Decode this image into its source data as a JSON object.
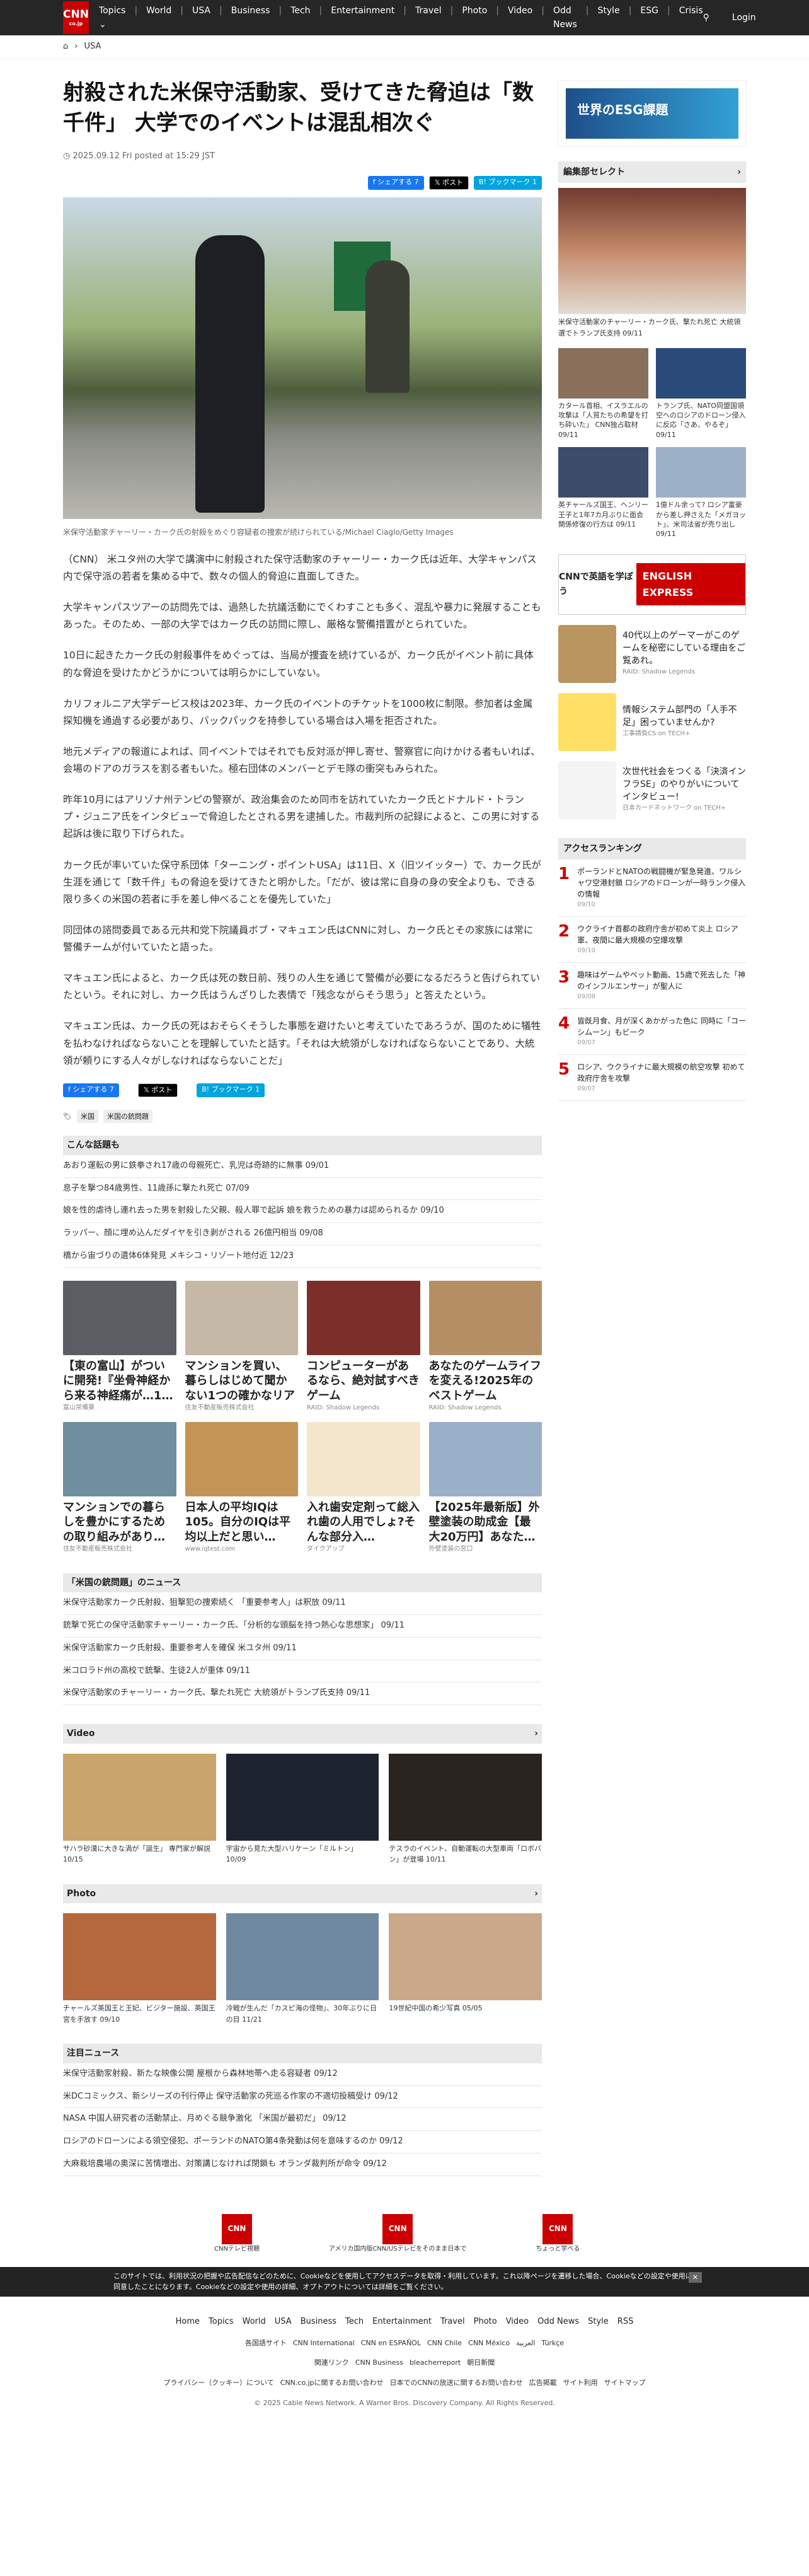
{
  "header": {
    "logo": "CNN",
    "logo_sub": "co.jp",
    "nav": [
      "Topics ⌄",
      "World",
      "USA",
      "Business",
      "Tech",
      "Entertainment",
      "Travel",
      "Photo",
      "Video",
      "Odd News",
      "Style",
      "ESG",
      "Crisis"
    ],
    "login": "Login"
  },
  "breadcrumb": {
    "section": "USA"
  },
  "article": {
    "title": "射殺された米保守活動家、受けてきた脅迫は「数千件」 大学でのイベントは混乱相次ぐ",
    "date": "2025.09.12 Fri posted at 15:29 JST",
    "share_fb": "f シェアする 7",
    "share_tw": "𝕏 ポスト",
    "share_hb": "B! ブックマーク 1",
    "caption": "米保守活動家チャーリー・カーク氏の射殺をめぐり容疑者の捜索が続けられている/Michael Ciaglo/Getty Images",
    "paragraphs": [
      "（CNN） 米ユタ州の大学で講演中に射殺された保守活動家のチャーリー・カーク氏は近年、大学キャンパス内で保守派の若者を集める中で、数々の個人的脅迫に直面してきた。",
      "大学キャンパスツアーの訪問先では、過熱した抗議活動にでくわすことも多く、混乱や暴力に発展することもあった。そのため、一部の大学ではカーク氏の訪問に際し、厳格な警備措置がとられていた。",
      "10日に起きたカーク氏の射殺事件をめぐっては、当局が捜査を続けているが、カーク氏がイベント前に具体的な脅迫を受けたかどうかについては明らかにしていない。",
      "カリフォルニア大学デービス校は2023年、カーク氏のイベントのチケットを1000枚に制限。参加者は金属探知機を通過する必要があり、バックパックを持参している場合は入場を拒否された。",
      "地元メディアの報道によれば、同イベントではそれでも反対派が押し寄せ、警察官に向けかける者もいれば、会場のドアのガラスを割る者もいた。極右団体のメンバーとデモ隊の衝突もみられた。",
      "昨年10月にはアリゾナ州テンピの警察が、政治集会のため同市を訪れていたカーク氏とドナルド・トランプ・ジュニア氏をインタビューで脅迫したとされる男を逮捕した。市裁判所の記録によると、この男に対する起訴は後に取り下げられた。",
      "カーク氏が率いていた保守系団体「ターニング・ポイントUSA」は11日、X（旧ツイッター）で、カーク氏が生涯を通じて「数千件」もの脅迫を受けてきたと明かした。「だが、彼は常に自身の身の安全よりも、できる限り多くの米国の若者に手を差し伸べることを優先していた」",
      "同団体の諮問委員である元共和党下院議員ボブ・マキュエン氏はCNNに対し、カーク氏とその家族には常に警備チームが付いていたと語った。",
      "マキュエン氏によると、カーク氏は死の数日前、残りの人生を通じて警備が必要になるだろうと告げられていたという。それに対し、カーク氏はうんざりした表情で「残念ながらそう思う」と答えたという。",
      "マキュエン氏は、カーク氏の死はおそらくそうした事態を避けたいと考えていたであろうが、国のために犠牲を払わなければならないことを理解していたと話す。「それは大統領がしなければならないことであり、大統領が頼りにする人々がしなければならないことだ」"
    ],
    "tags": [
      "米国",
      "米国の銃問題"
    ]
  },
  "recommend": {
    "title": "こんな話題も",
    "items": [
      "あおり運転の男に鉄拳され17歳の母親死亡、乳児は奇跡的に無事 09/01",
      "息子を撃つ84歳男性、11歳孫に撃たれ死亡 07/09",
      "娘を性的虐待し連れ去った男を射殺した父親、殺人罪で起訴 娘を救うための暴力は認められるか 09/10",
      "ラッパー、顔に埋め込んだダイヤを引き剥がされる 26億円相当 09/08",
      "橋から宙づりの遺体6体発見 メキシコ・リゾート地付近 12/23"
    ]
  },
  "ads": [
    {
      "title": "【東の富山】がついに開発!『坐骨神経から来る神経痛が…1…",
      "src": "富山常備薬",
      "color": "#5a5d62"
    },
    {
      "title": "マンションを買い、暮らしはじめて聞かない1つの確かなリアル…",
      "src": "住友不動産販売株式会社",
      "color": "#c6b8a6"
    },
    {
      "title": "コンピューターがあるなら、絶対試すべきゲーム",
      "src": "RAID: Shadow Legends",
      "color": "#7b2e2a"
    },
    {
      "title": "あなたのゲームライフを変える!2025年のベストゲーム",
      "src": "RAID: Shadow Legends",
      "color": "#b58f63"
    },
    {
      "title": "マンションでの暮らしを豊かにするための取り組みがあり…",
      "src": "住友不動産販売株式会社",
      "color": "#6f8f9e"
    },
    {
      "title": "日本人の平均IQは105。自分のIQは平均以上だと思い…",
      "src": "www.iqtest.com",
      "color": "#c29455"
    },
    {
      "title": "入れ歯安定剤って総入れ歯の人用でしょ?そんな部分入…",
      "src": "ダイクアップ",
      "color": "#f3e6cc"
    },
    {
      "title": "【2025年最新版】外壁塗装の助成金【最大20万円】あなた…",
      "src": "外壁塗装の窓口",
      "color": "#9ab0c8"
    }
  ],
  "news_gun": {
    "title": "「米国の銃問題」のニュース",
    "items": [
      "米保守活動家カーク氏射殺、狙撃犯の捜索続く 「重要参考人」は釈放 09/11",
      "銃撃で死亡の保守活動家チャーリー・カーク氏、「分析的な頭脳を持つ熱心な思想家」 09/11",
      "米保守活動家カーク氏射殺、重要参考人を確保 米ユタ州 09/11",
      "米コロラド州の高校で銃撃、生徒2人が重体 09/11",
      "米保守活動家のチャーリー・カーク氏、撃たれ死亡 大統領がトランプ氏支持 09/11"
    ]
  },
  "video": {
    "title": "Video",
    "items": [
      {
        "t": "サハラ砂漠に大きな渦が「誕生」 専門家が解説 10/15",
        "c": "#c9a46b"
      },
      {
        "t": "宇宙から見た大型ハリケーン「ミルトン」 10/09",
        "c": "#1d2430"
      },
      {
        "t": "テスラのイベント、自動運転の大型車両「ロボバン」が登場 10/11",
        "c": "#2a2420"
      }
    ]
  },
  "photo": {
    "title": "Photo",
    "items": [
      {
        "t": "チャールズ英国王と王妃、ビジター施設、英国王宮を手放す 09/10",
        "c": "#b5673d"
      },
      {
        "t": "冷戦が生んだ「カスピ海の怪物」、30年ぶりに日の目 11/21",
        "c": "#6f8aa0"
      },
      {
        "t": "19世紀中国の希少写真 05/05",
        "c": "#c9a98a"
      }
    ]
  },
  "notable": {
    "title": "注目ニュース",
    "items": [
      "米保守活動家射殺、新たな映像公開 屋根から森林地帯へ走る容疑者 09/12",
      "米DCコミックス、新シリーズの刊行停止 保守活動家の死巡る作家の不適切投稿受け 09/12",
      "NASA 中国人研究者の活動禁止、月めぐる競争激化 「米国が最初だ」 09/12",
      "ロシアのドローンによる領空侵犯、ポーランドのNATO第4条発動は何を意味するのか 09/12",
      "大麻栽培農場の奥深に苦情増出、対策講じなければ閉鎖も オランダ裁判所が命令 09/12"
    ]
  },
  "sidebar": {
    "esg": "世界のESG課題",
    "editors": "編集部セレクト",
    "main_cap": "米保守活動家のチャーリー・カーク氏、撃たれ死亡 大統領選でトランプ氏支持 09/11",
    "grid": [
      {
        "cap": "カタール首相、イスラエルの攻撃は「人質たちの希望を打ち砕いた」 CNN独占取材 09/11",
        "c": "#8a6f5a"
      },
      {
        "cap": "トランプ氏、NATO同盟国領空へのロシアのドローン侵入に反応「さあ、やるぞ」 09/11",
        "c": "#2a4a7a"
      },
      {
        "cap": "英チャールズ国王、ヘンリー王子と1年7カ月ぶりに面会 関係修復の行方は 09/11",
        "c": "#3c4c6a"
      },
      {
        "cap": "1億ドル余って? ロシア富豪から差し押さえた「メガヨット」、米司法省が売り出し 09/11",
        "c": "#9cb0c8"
      }
    ],
    "english": "CNNで英語を学ぼう",
    "english2": "ENGLISH EXPRESS",
    "pr": [
      {
        "t": "40代以上のゲーマーがこのゲームを秘密にしている理由をご覧あれ。",
        "s": "RAID: Shadow Legends",
        "c": "#b9955f"
      },
      {
        "t": "情報システム部門の「人手不足」困っていませんか?",
        "s": "工事請負CS on TECH+",
        "c": "#ffe066"
      },
      {
        "t": "次世代社会をつくる「決済インフラSE」のやりがいについてインタビュー!",
        "s": "日本カードネットワーク on TECH+",
        "c": "#f4f4f4"
      }
    ],
    "ranking_title": "アクセスランキング",
    "ranking": [
      {
        "t": "ポーランドとNATOの戦闘機が緊急発進、ワルシャワ空港封鎖 ロシアのドローンが一時ランク侵入の情報",
        "d": "09/10"
      },
      {
        "t": "ウクライナ首都の政府庁舎が初めて炎上 ロシア軍、夜間に最大規模の空爆攻撃",
        "d": "09/10"
      },
      {
        "t": "趣味はゲームやペット動画、15歳で死去した「神のインフルエンサー」が聖人に",
        "d": "09/08"
      },
      {
        "t": "皆既月食、月が深くあかがった色に 同時に「コーシムーン」もビーク",
        "d": "09/07"
      },
      {
        "t": "ロシア、ウクライナに最大規模の航空攻撃 初めて政府庁舎を攻撃",
        "d": "09/07"
      }
    ]
  },
  "footer": {
    "icons": [
      {
        "b": "CNN",
        "l": "CNNテレビ視聴"
      },
      {
        "b": "CNN",
        "l": "アメリカ国内版CNN/USテレビをそのまま日本で"
      },
      {
        "b": "CNN",
        "l": "ちょっと学べる"
      }
    ],
    "cookie": "このサイトでは、利用状況の把握や広告配信などのために、Cookieなどを使用してアクセスデータを取得・利用しています。これ以降ページを遷移した場合、Cookieなどの設定や使用に同意したことになります。Cookieなどの設定や使用の詳細、オプトアウトについては詳細をご覧ください。",
    "links": [
      "Home",
      "Topics",
      "World",
      "USA",
      "Business",
      "Tech",
      "Entertainment",
      "Travel",
      "Photo",
      "Video",
      "Odd News",
      "Style",
      "RSS"
    ],
    "intl": [
      "各国語サイト",
      "CNN International",
      "CNN en ESPAÑOL",
      "CNN Chile",
      "CNN México",
      "العربية",
      "Türkçe"
    ],
    "intl2": [
      "関連リンク",
      "CNN Business",
      "bleacherreport",
      "朝日新聞"
    ],
    "small": [
      "プライバシー（クッキー）について",
      "CNN.co.jpに関するお問い合わせ",
      "日本でのCNNの放送に関するお問い合わせ",
      "広告掲載",
      "サイト利用",
      "サイトマップ"
    ],
    "copy": "© 2025 Cable News Network. A Warner Bros. Discovery Company. All Rights Reserved."
  }
}
